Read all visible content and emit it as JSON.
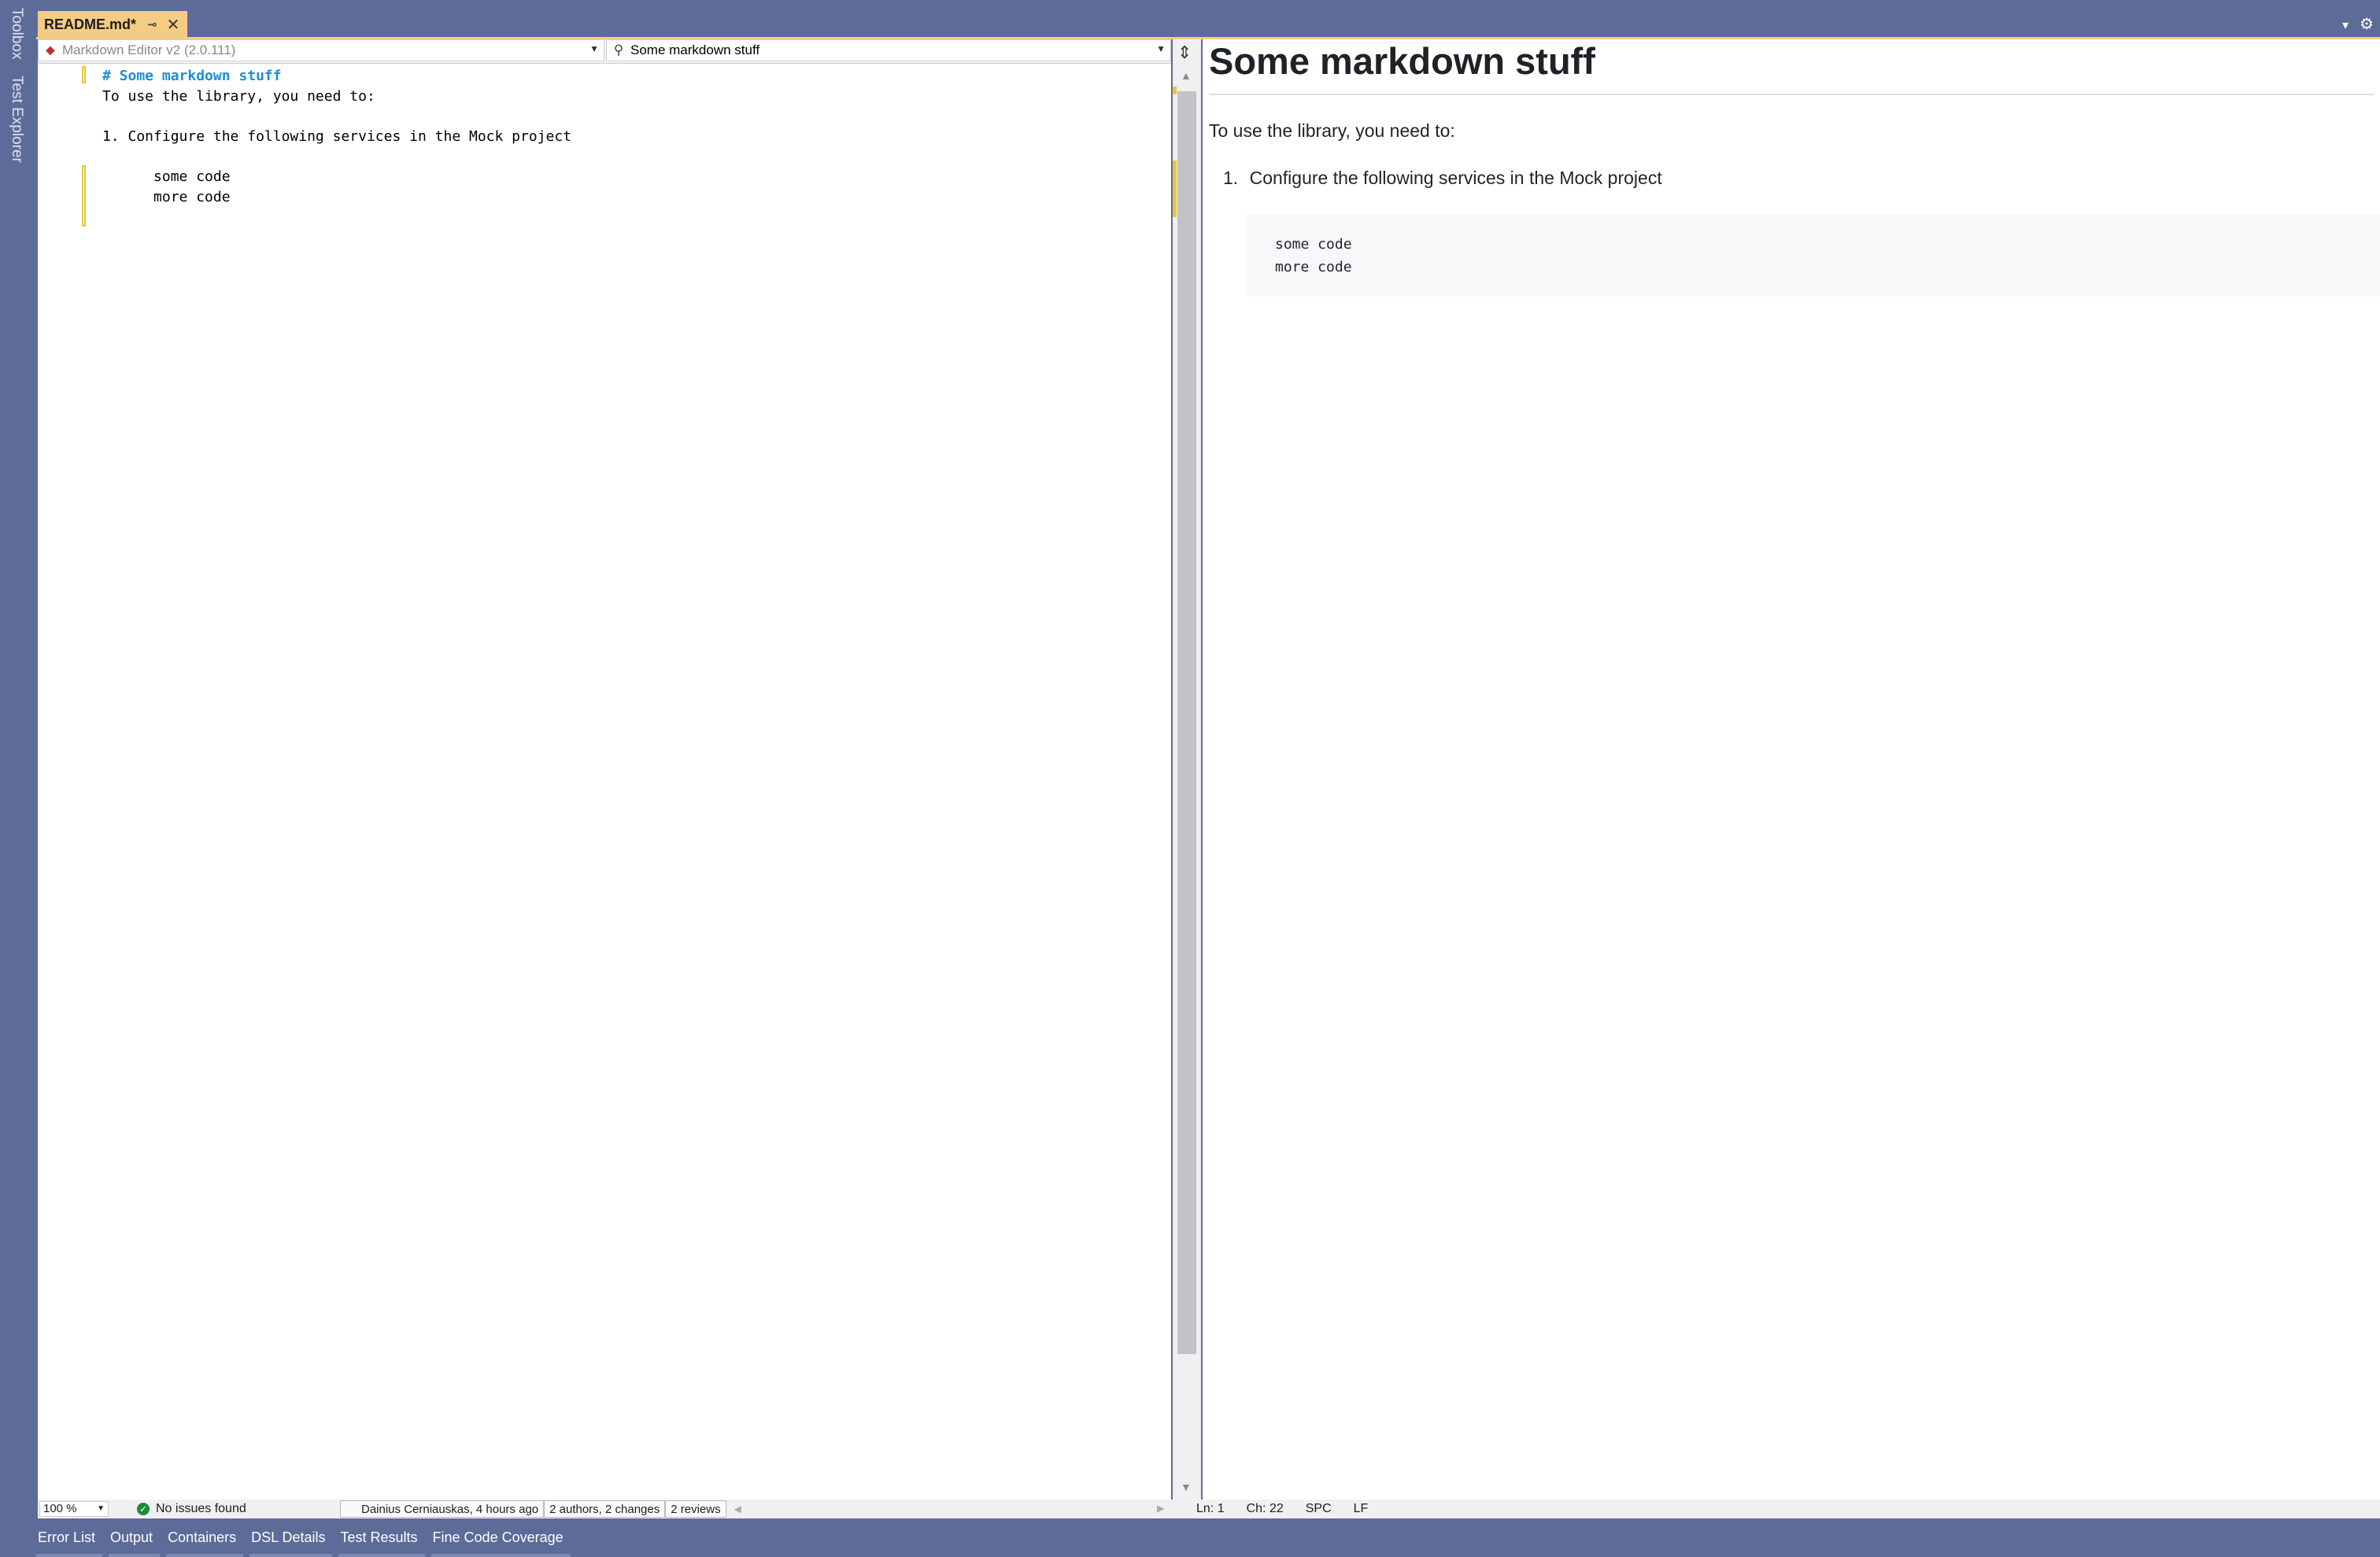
{
  "side_tabs": [
    "Toolbox",
    "Test Explorer"
  ],
  "doc_tab": {
    "title": "README.md*",
    "pin": "⊸",
    "close": "✕"
  },
  "editor": {
    "nav_left": "Markdown Editor v2 (2.0.111)",
    "nav_right": "Some markdown stuff",
    "lines": [
      "# Some markdown stuff",
      "To use the library, you need to:",
      "",
      "1. Configure the following services in the Mock project",
      "",
      "      some code",
      "      more code"
    ]
  },
  "preview": {
    "heading": "Some markdown stuff",
    "paragraph": "To use the library, you need to:",
    "list_item_number": "1.",
    "list_item": "Configure the following services in the Mock project",
    "code_block": "some code\nmore code"
  },
  "status": {
    "zoom": "100 %",
    "issues": "No issues found",
    "git_author": "Dainius Cerniauskas, 4 hours ago",
    "git_authors": "2 authors, 2 changes",
    "git_reviews": "2 reviews",
    "line": "Ln: 1",
    "char": "Ch: 22",
    "spacing": "SPC",
    "eol": "LF"
  },
  "bottom_tabs": [
    "Error List",
    "Output",
    "Containers",
    "DSL Details",
    "Test Results",
    "Fine Code Coverage"
  ],
  "colors": {
    "chrome": "#5d6b99",
    "tab_active": "#f5cc84",
    "heading_md": "#1b8fd6",
    "change_marker": "#e6c740"
  }
}
